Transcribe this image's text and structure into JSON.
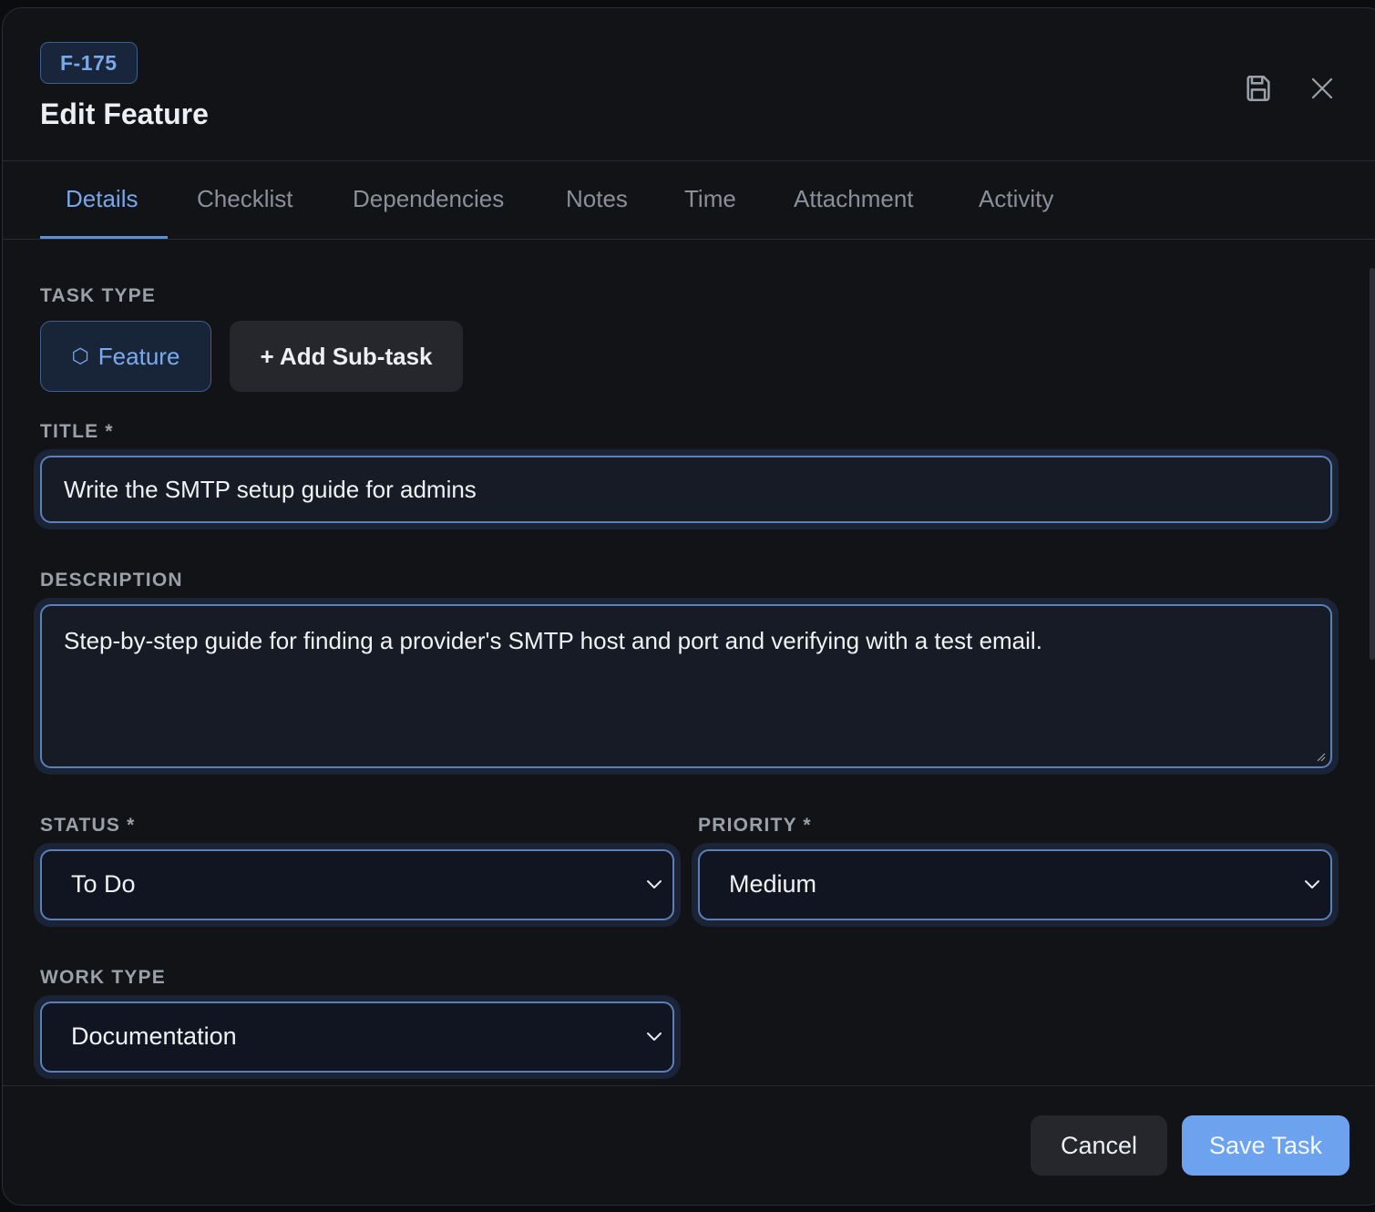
{
  "header": {
    "id_badge": "F-175",
    "title": "Edit Feature"
  },
  "icons": {
    "save": "save-icon",
    "close": "close-icon"
  },
  "tabs": [
    {
      "label": "Details",
      "active": true
    },
    {
      "label": "Checklist"
    },
    {
      "label": "Dependencies"
    },
    {
      "label": "Notes"
    },
    {
      "label": "Time"
    },
    {
      "label": "Attachment"
    },
    {
      "label": "Activity"
    }
  ],
  "task_type": {
    "label": "TASK TYPE",
    "feature_icon": "⬡",
    "feature_label": "Feature",
    "add_subtask_label": "+ Add Sub-task"
  },
  "title_field": {
    "label": "TITLE *",
    "value": "Write the SMTP setup guide for admins"
  },
  "description_field": {
    "label": "DESCRIPTION",
    "value": "Step-by-step guide for finding a provider's SMTP host and port and verifying with a test email."
  },
  "status_field": {
    "label": "STATUS *",
    "value": "To Do"
  },
  "priority_field": {
    "label": "PRIORITY *",
    "value": "Medium"
  },
  "work_type_field": {
    "label": "WORK TYPE",
    "value": "Documentation"
  },
  "footer": {
    "cancel_label": "Cancel",
    "save_label": "Save Task"
  },
  "colors": {
    "accent": "#6da3ee",
    "background": "#111317",
    "field_border": "#5d7fb8"
  }
}
